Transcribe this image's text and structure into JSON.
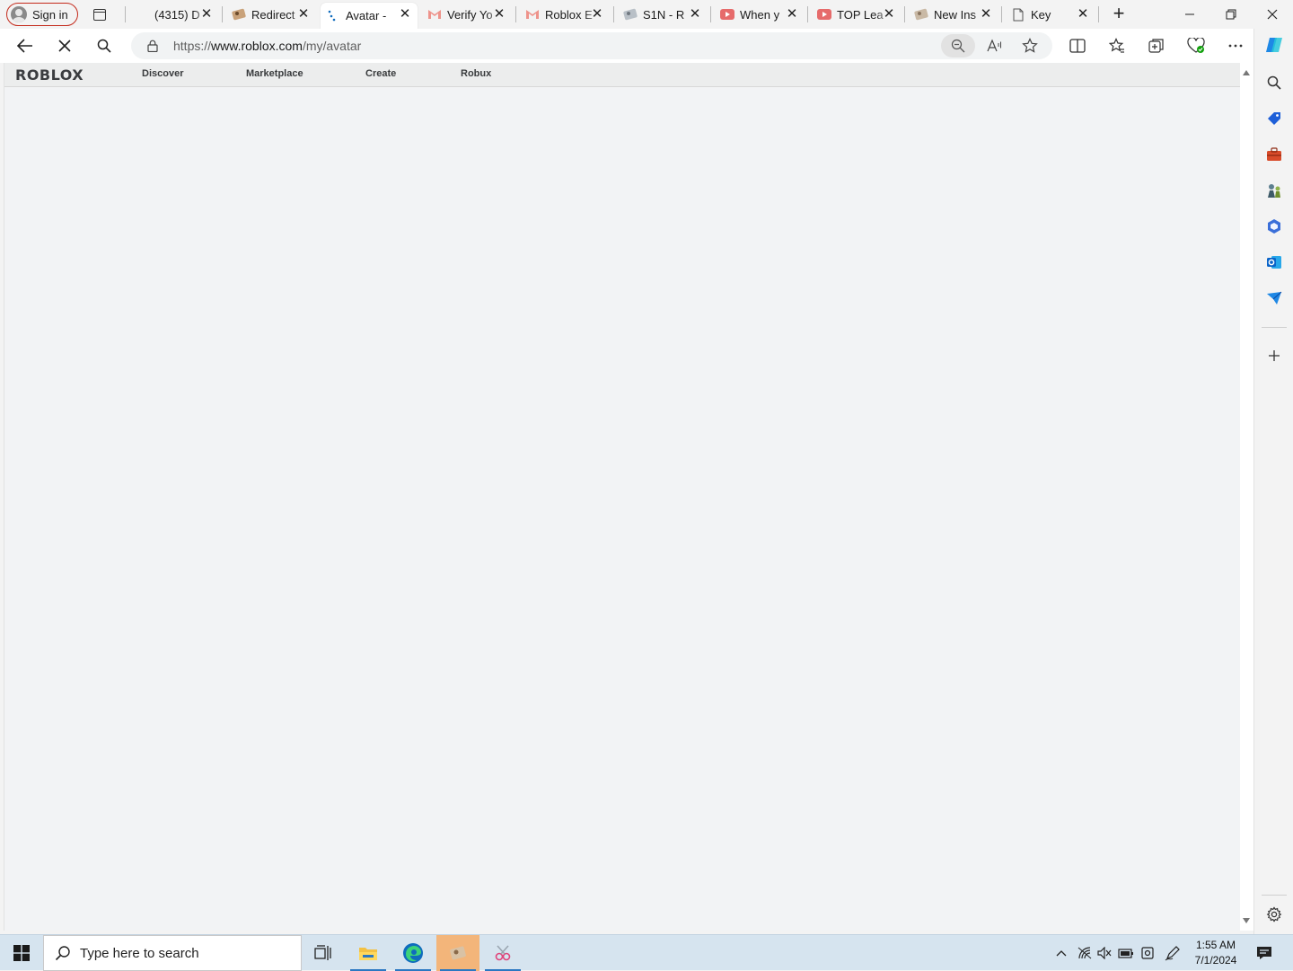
{
  "browser": {
    "profile_label": "Sign in",
    "tabs": [
      {
        "title": "(4315) D",
        "icon": "discord-icon"
      },
      {
        "title": "Redirect",
        "icon": "roblox-avatar-icon"
      },
      {
        "title": "Avatar -",
        "icon": "loading-spinner-icon",
        "active": true
      },
      {
        "title": "Verify Yo",
        "icon": "gmail-icon"
      },
      {
        "title": "Roblox E",
        "icon": "gmail-icon"
      },
      {
        "title": "S1N - R",
        "icon": "roblox-avatar-icon"
      },
      {
        "title": "When y",
        "icon": "youtube-icon"
      },
      {
        "title": "TOP Lea",
        "icon": "youtube-icon"
      },
      {
        "title": "New Ins",
        "icon": "roblox-avatar-icon"
      },
      {
        "title": "Key",
        "icon": "page-icon"
      }
    ],
    "url_scheme": "https://",
    "url_host": "www.roblox.com",
    "url_path": "/my/avatar",
    "colors": {
      "profile_ring": "#c42b1c",
      "gmail_red": "#ea4335",
      "youtube_red": "#ff0000",
      "edge_blue": "#0f6cbd"
    }
  },
  "site_nav": {
    "logo": "ROBLOX",
    "links": [
      "Discover",
      "Marketplace",
      "Create",
      "Robux"
    ]
  },
  "taskbar": {
    "search_placeholder": "Type here to search",
    "time": "1:55 AM",
    "date": "7/1/2024"
  }
}
